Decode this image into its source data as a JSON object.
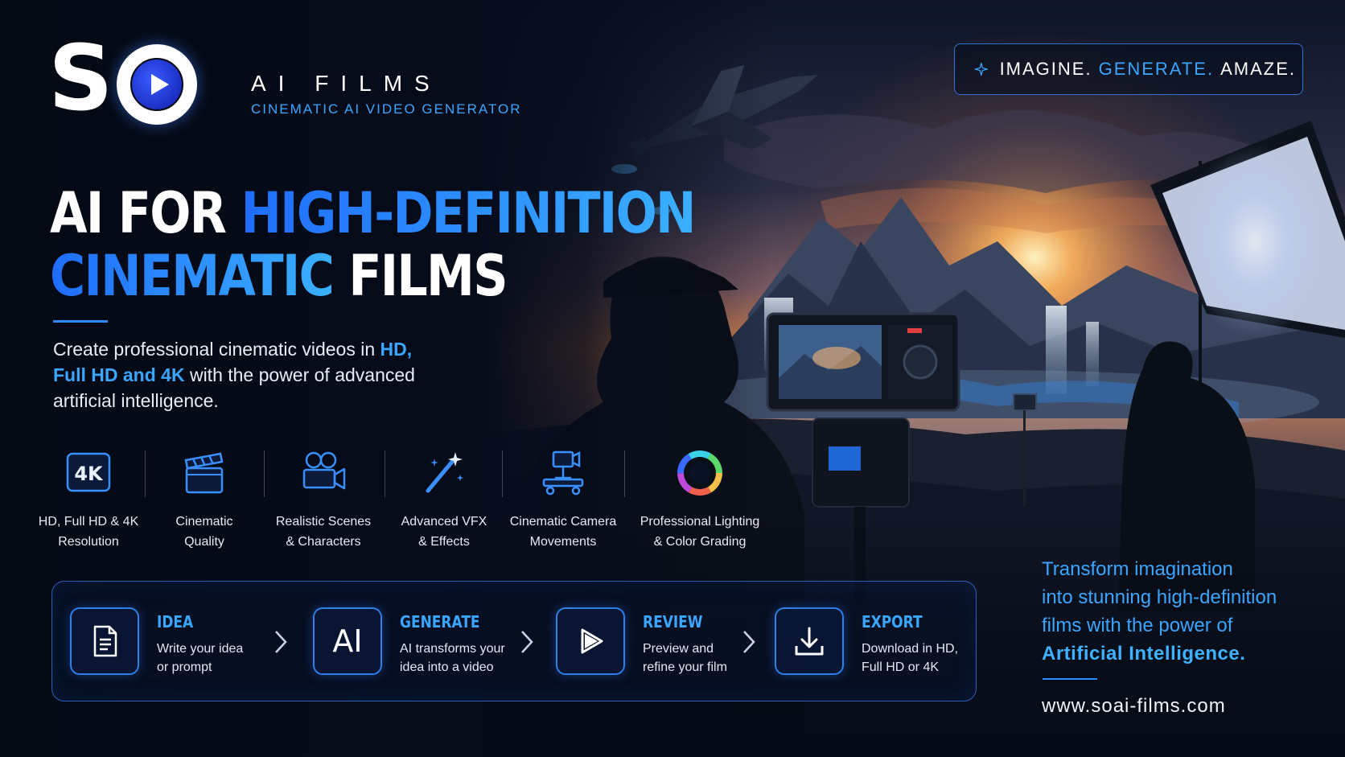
{
  "logo": {
    "mark_text": "S",
    "name": "AI FILMS",
    "tagline": "CINEMATIC AI VIDEO GENERATOR"
  },
  "tagline_pill": {
    "icon": "sparkle-icon",
    "word1": "IMAGINE.",
    "word2": "GENERATE.",
    "word3": "AMAZE."
  },
  "headline": {
    "part1": "AI FOR ",
    "part2": "HIGH-DEFINITION",
    "part3": "CINEMATIC",
    "part4": " FILMS"
  },
  "intro": {
    "before": "Create professional cinematic videos in ",
    "highlight": "HD, Full HD and 4K",
    "after": " with the power of advanced artificial intelligence."
  },
  "features": [
    {
      "icon": "4k-icon",
      "icon_text": "4K",
      "line1": "HD, Full HD & 4K",
      "line2": "Resolution"
    },
    {
      "icon": "clapperboard-icon",
      "line1": "Cinematic",
      "line2": "Quality"
    },
    {
      "icon": "movie-camera-icon",
      "line1": "Realistic Scenes",
      "line2": "& Characters"
    },
    {
      "icon": "magic-wand-icon",
      "line1": "Advanced VFX",
      "line2": "& Effects"
    },
    {
      "icon": "camera-dolly-icon",
      "line1": "Cinematic Camera",
      "line2": "Movements"
    },
    {
      "icon": "color-wheel-icon",
      "line1": "Professional Lighting",
      "line2": "& Color Grading"
    }
  ],
  "steps": [
    {
      "icon": "document-icon",
      "title": "IDEA",
      "line1": "Write your idea",
      "line2": "or prompt"
    },
    {
      "icon": "ai-icon",
      "icon_text": "AI",
      "title": "GENERATE",
      "line1": "AI transforms your",
      "line2": "idea into a video"
    },
    {
      "icon": "play-icon",
      "title": "REVIEW",
      "line1": "Preview and",
      "line2": "refine your film"
    },
    {
      "icon": "download-icon",
      "title": "EXPORT",
      "line1": "Download in HD,",
      "line2": "Full HD or 4K"
    }
  ],
  "transform": {
    "line1": "Transform imagination",
    "line2": "into stunning high-definition",
    "line3": "films with the power of",
    "line4": "Artificial Intelligence."
  },
  "website": "www.soai-films.com",
  "colors": {
    "accent": "#3aa6ff",
    "deep_blue": "#1f6dff",
    "background": "#050a16",
    "sunset": "#f29a4a"
  }
}
